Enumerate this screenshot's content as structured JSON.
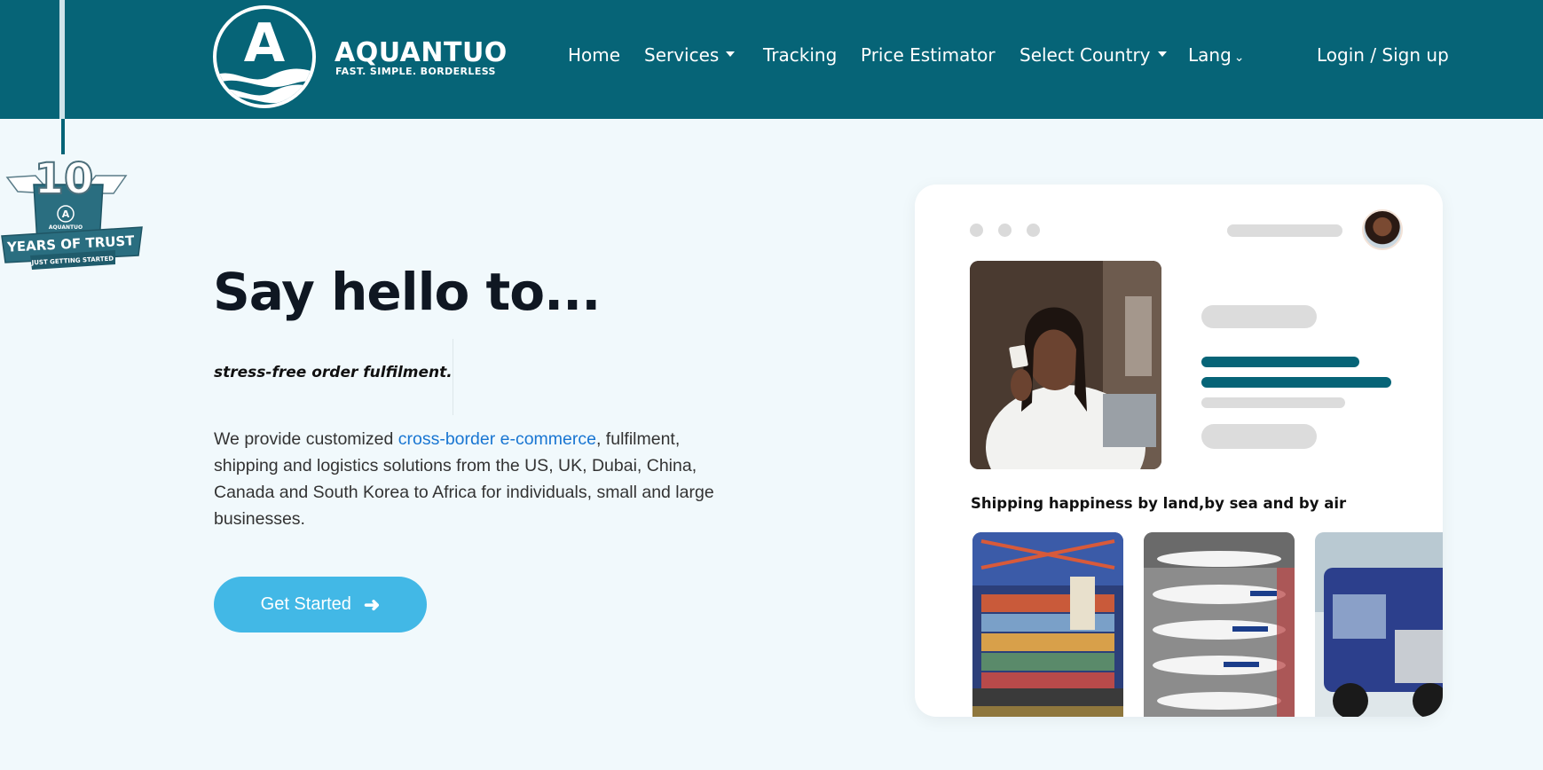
{
  "brand": {
    "name": "AQUANTUO",
    "tagline": "FAST. SIMPLE. BORDERLESS",
    "logo_letter": "A"
  },
  "nav": {
    "home": "Home",
    "services": "Services",
    "tracking": "Tracking",
    "price_estimator": "Price Estimator",
    "select_country": "Select Country",
    "lang": "Lang",
    "login": "Login / Sign up"
  },
  "badge": {
    "number": "10",
    "brand": "AQUANTUO",
    "title": "YEARS OF TRUST",
    "subtitle": "JUST GETTING STARTED"
  },
  "hero": {
    "title": "Say hello to...",
    "subtitle": "stress-free order fulfilment.",
    "desc_before": "We provide customized ",
    "desc_link": "cross-border e-commerce",
    "desc_after": ", fulfilment, shipping and logistics solutions from the US, UK, Dubai, China, Canada and South Korea to Africa for individuals, small and large businesses.",
    "cta": "Get Started"
  },
  "card": {
    "caption": "Shipping happiness by land,by sea and by air"
  },
  "icons": {
    "services_caret": "caret-down-icon",
    "country_caret": "caret-down-icon",
    "lang_chevron": "chevron-down-icon",
    "cta_arrow": "arrow-right-icon"
  },
  "colors": {
    "header": "#066477",
    "background": "#f1f9fc",
    "cta": "#42b8e6",
    "link": "#1976d2"
  }
}
